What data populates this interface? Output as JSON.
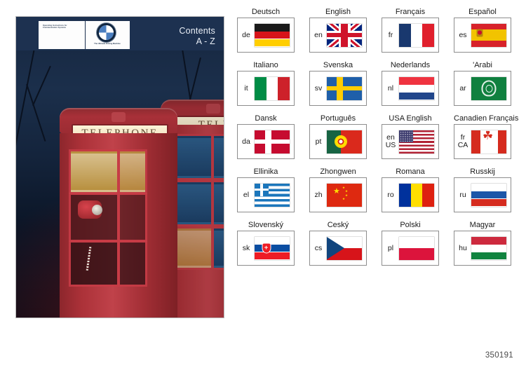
{
  "document": {
    "reference_number": "350191"
  },
  "cover": {
    "imprint_lines": "Operating Instructions for Communication Systems",
    "brand_icon": "bmw-roundel-icon",
    "brand_tagline": "The Ultimate Driving Machine",
    "contents_title": "Contents",
    "contents_range": "A - Z",
    "photo_subject": "red british telephone boxes at dusk",
    "sign_text": "TELEPHONE",
    "sign_text_partial": "TELE"
  },
  "languages": [
    {
      "name": "Deutsch",
      "code": "de",
      "flag": "flag-germany"
    },
    {
      "name": "English",
      "code": "en",
      "flag": "flag-united-kingdom"
    },
    {
      "name": "Français",
      "code": "fr",
      "flag": "flag-france"
    },
    {
      "name": "Español",
      "code": "es",
      "flag": "flag-spain"
    },
    {
      "name": "Italiano",
      "code": "it",
      "flag": "flag-italy"
    },
    {
      "name": "Svenska",
      "code": "sv",
      "flag": "flag-sweden"
    },
    {
      "name": "Nederlands",
      "code": "nl",
      "flag": "flag-netherlands"
    },
    {
      "name": "'Arabi",
      "code": "ar",
      "flag": "flag-arab-league"
    },
    {
      "name": "Dansk",
      "code": "da",
      "flag": "flag-denmark"
    },
    {
      "name": "Português",
      "code": "pt",
      "flag": "flag-portugal"
    },
    {
      "name": "USA English",
      "code": "en\nUS",
      "flag": "flag-united-states"
    },
    {
      "name": "Canadien Français",
      "code": "fr\nCA",
      "flag": "flag-canada"
    },
    {
      "name": "Ellinika",
      "code": "el",
      "flag": "flag-greece"
    },
    {
      "name": "Zhongwen",
      "code": "zh",
      "flag": "flag-china"
    },
    {
      "name": "Romana",
      "code": "ro",
      "flag": "flag-romania"
    },
    {
      "name": "Russkij",
      "code": "ru",
      "flag": "flag-russia"
    },
    {
      "name": "Slovenský",
      "code": "sk",
      "flag": "flag-slovakia"
    },
    {
      "name": "Ceský",
      "code": "cs",
      "flag": "flag-czech-republic"
    },
    {
      "name": "Polski",
      "code": "pl",
      "flag": "flag-poland"
    },
    {
      "name": "Magyar",
      "code": "hu",
      "flag": "flag-hungary"
    }
  ],
  "colors": {
    "page_background": "#ffffff",
    "card_border": "#8d8d8d",
    "cover_sky": "#1b2f4b",
    "cover_red": "#ab3138",
    "label_text": "#1a1a1a",
    "ref_text": "#4a4a4a"
  }
}
